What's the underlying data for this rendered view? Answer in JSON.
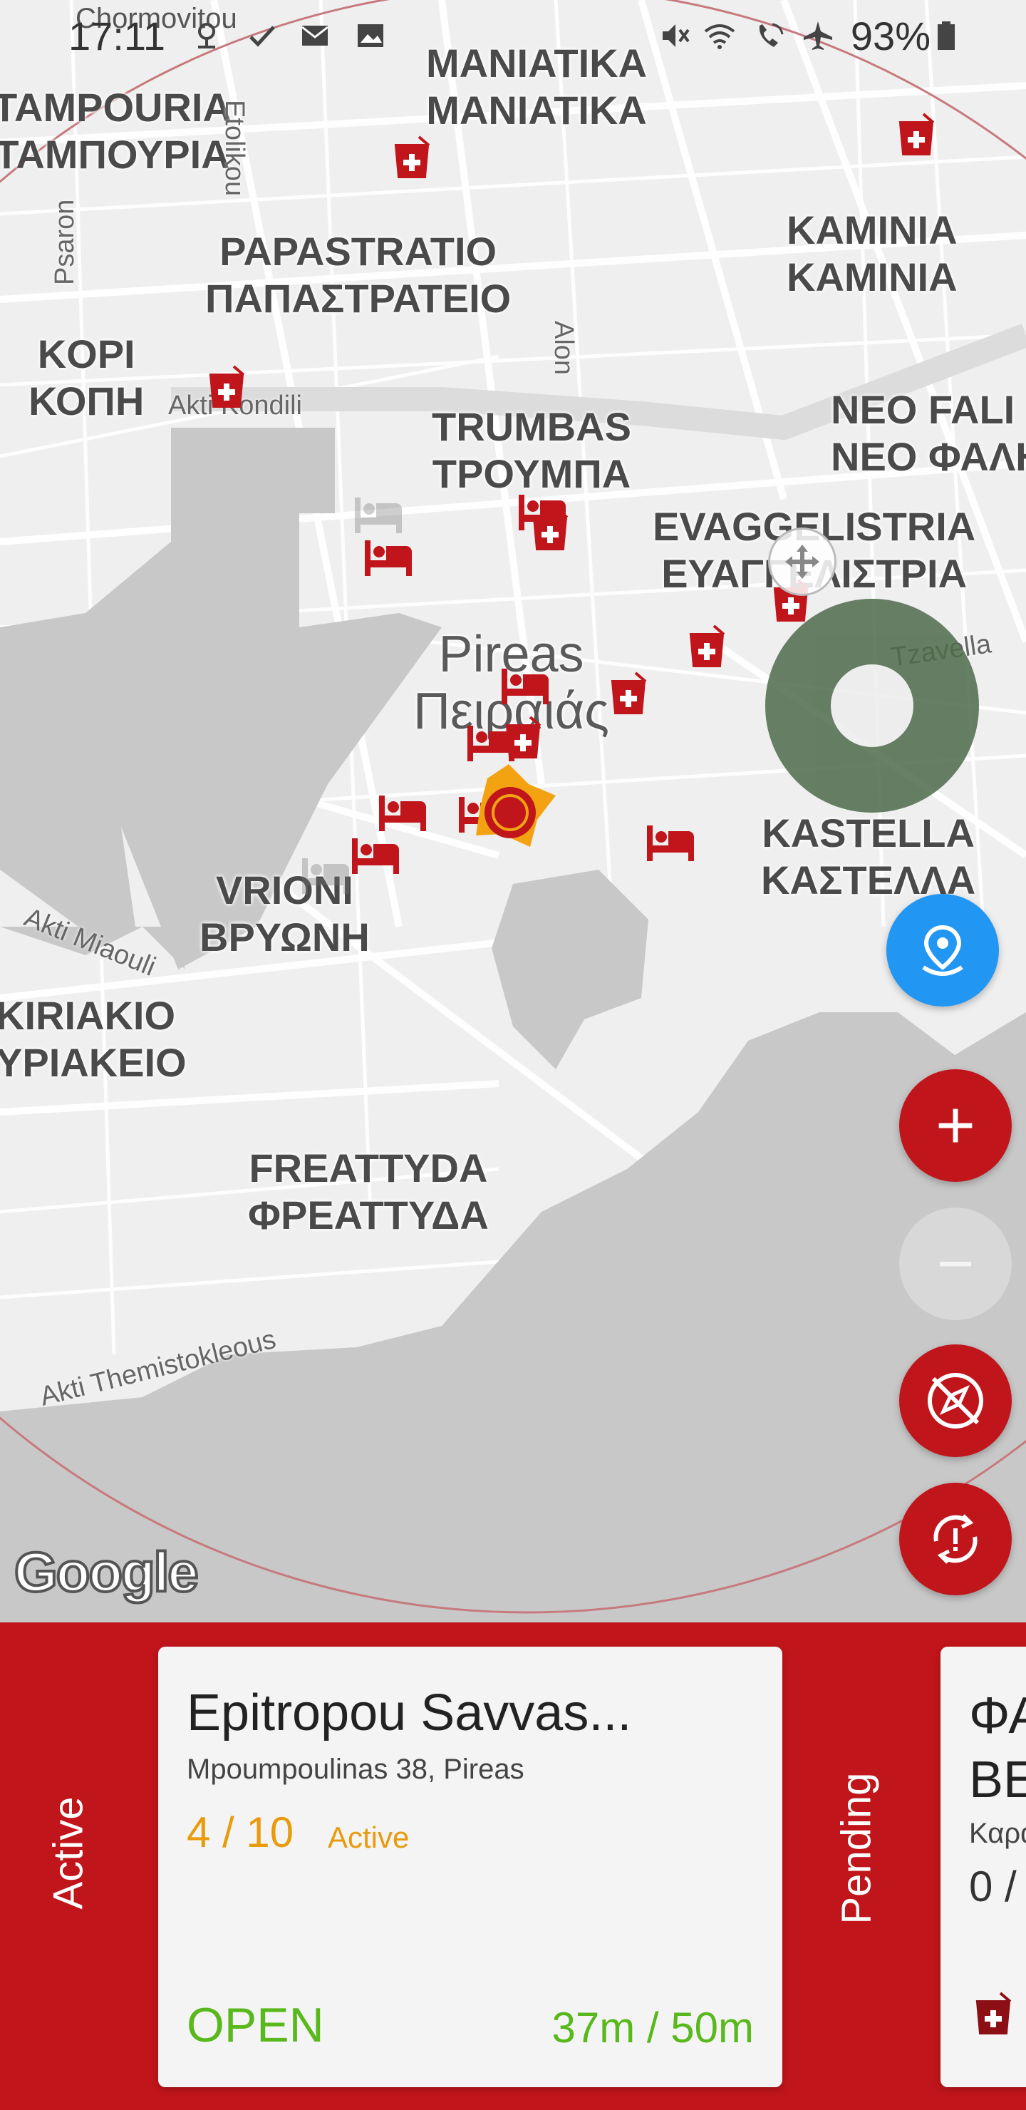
{
  "status_bar": {
    "time": "17:11",
    "battery": "93%",
    "overlay_text": "Chormovitou"
  },
  "map": {
    "districts": [
      {
        "id": "maniatika",
        "en": "MANIATIKA",
        "gr": "ΜΑΝΙΑΤΙΚΑ"
      },
      {
        "id": "tampouria",
        "en": "TAMPOURIA",
        "gr": "ΤΑΜΠΟΥΡΙΑ"
      },
      {
        "id": "papastratio",
        "en": "PAPASTRATIO",
        "gr": "ΠΑΠΑΣΤΡΑΤΕΙΟ"
      },
      {
        "id": "kaminia",
        "en": "KAMINIA",
        "gr": "ΚΑΜΙΝΙΑ"
      },
      {
        "id": "kopi",
        "en": "KOPI",
        "gr": "ΚΟΠΗ"
      },
      {
        "id": "trumbas",
        "en": "TRUMBAS",
        "gr": "ΤΡΟΥΜΠΑ"
      },
      {
        "id": "neofaliro",
        "en": "NEO FALI",
        "gr": "ΝΕΟ ΦΑΛΗ"
      },
      {
        "id": "evaggelistria",
        "en": "EVAGGELISTRIA",
        "gr": "ΕΥΑΓΓΕΛΙΣΤΡΙΑ"
      },
      {
        "id": "kastella",
        "en": "KASTELLA",
        "gr": "ΚΑΣΤΕΛΛΑ"
      },
      {
        "id": "vrioni",
        "en": "VRIONI",
        "gr": "ΒΡΥΩΝΗ"
      },
      {
        "id": "kiriakio",
        "en": "KIRIAKIO",
        "gr": "ΥΡΙΑΚΕΙΟ"
      },
      {
        "id": "freattyda",
        "en": "FREATTYDA",
        "gr": "ΦΡΕΑΤΤΥΔΑ"
      }
    ],
    "city": {
      "en": "Pireas",
      "gr": "Πειραιάς"
    },
    "streets": {
      "etolikou": "Etolikou",
      "psaron": "Psaron",
      "alon": "Alon",
      "akti_kondili": "Akti Kondili",
      "tzavella": "Tzavella",
      "akti_miaouli": "Akti Miaouli",
      "akti_themistokleous": "Akti Themistokleous"
    },
    "attribution": "Google"
  },
  "controls": {
    "zoom_in": "+",
    "zoom_out": "−"
  },
  "colors": {
    "brand_red": "#c0151b",
    "open_green": "#58b81c",
    "active_orange": "#e89b0c",
    "locate_blue": "#2196f3"
  },
  "tabs": {
    "active": "Active",
    "pending": "Pending"
  },
  "cards": [
    {
      "title": "Epitropou Savvas...",
      "address": "Mpoumpoulinas 38, Pireas",
      "count": "4 / 10",
      "status": "Active",
      "state": "OPEN",
      "distance": "37m / 50m"
    },
    {
      "title_line1": "ΦΑ",
      "title_line2": "ΒΕ",
      "address": "Καρα",
      "count": "0 /"
    }
  ]
}
